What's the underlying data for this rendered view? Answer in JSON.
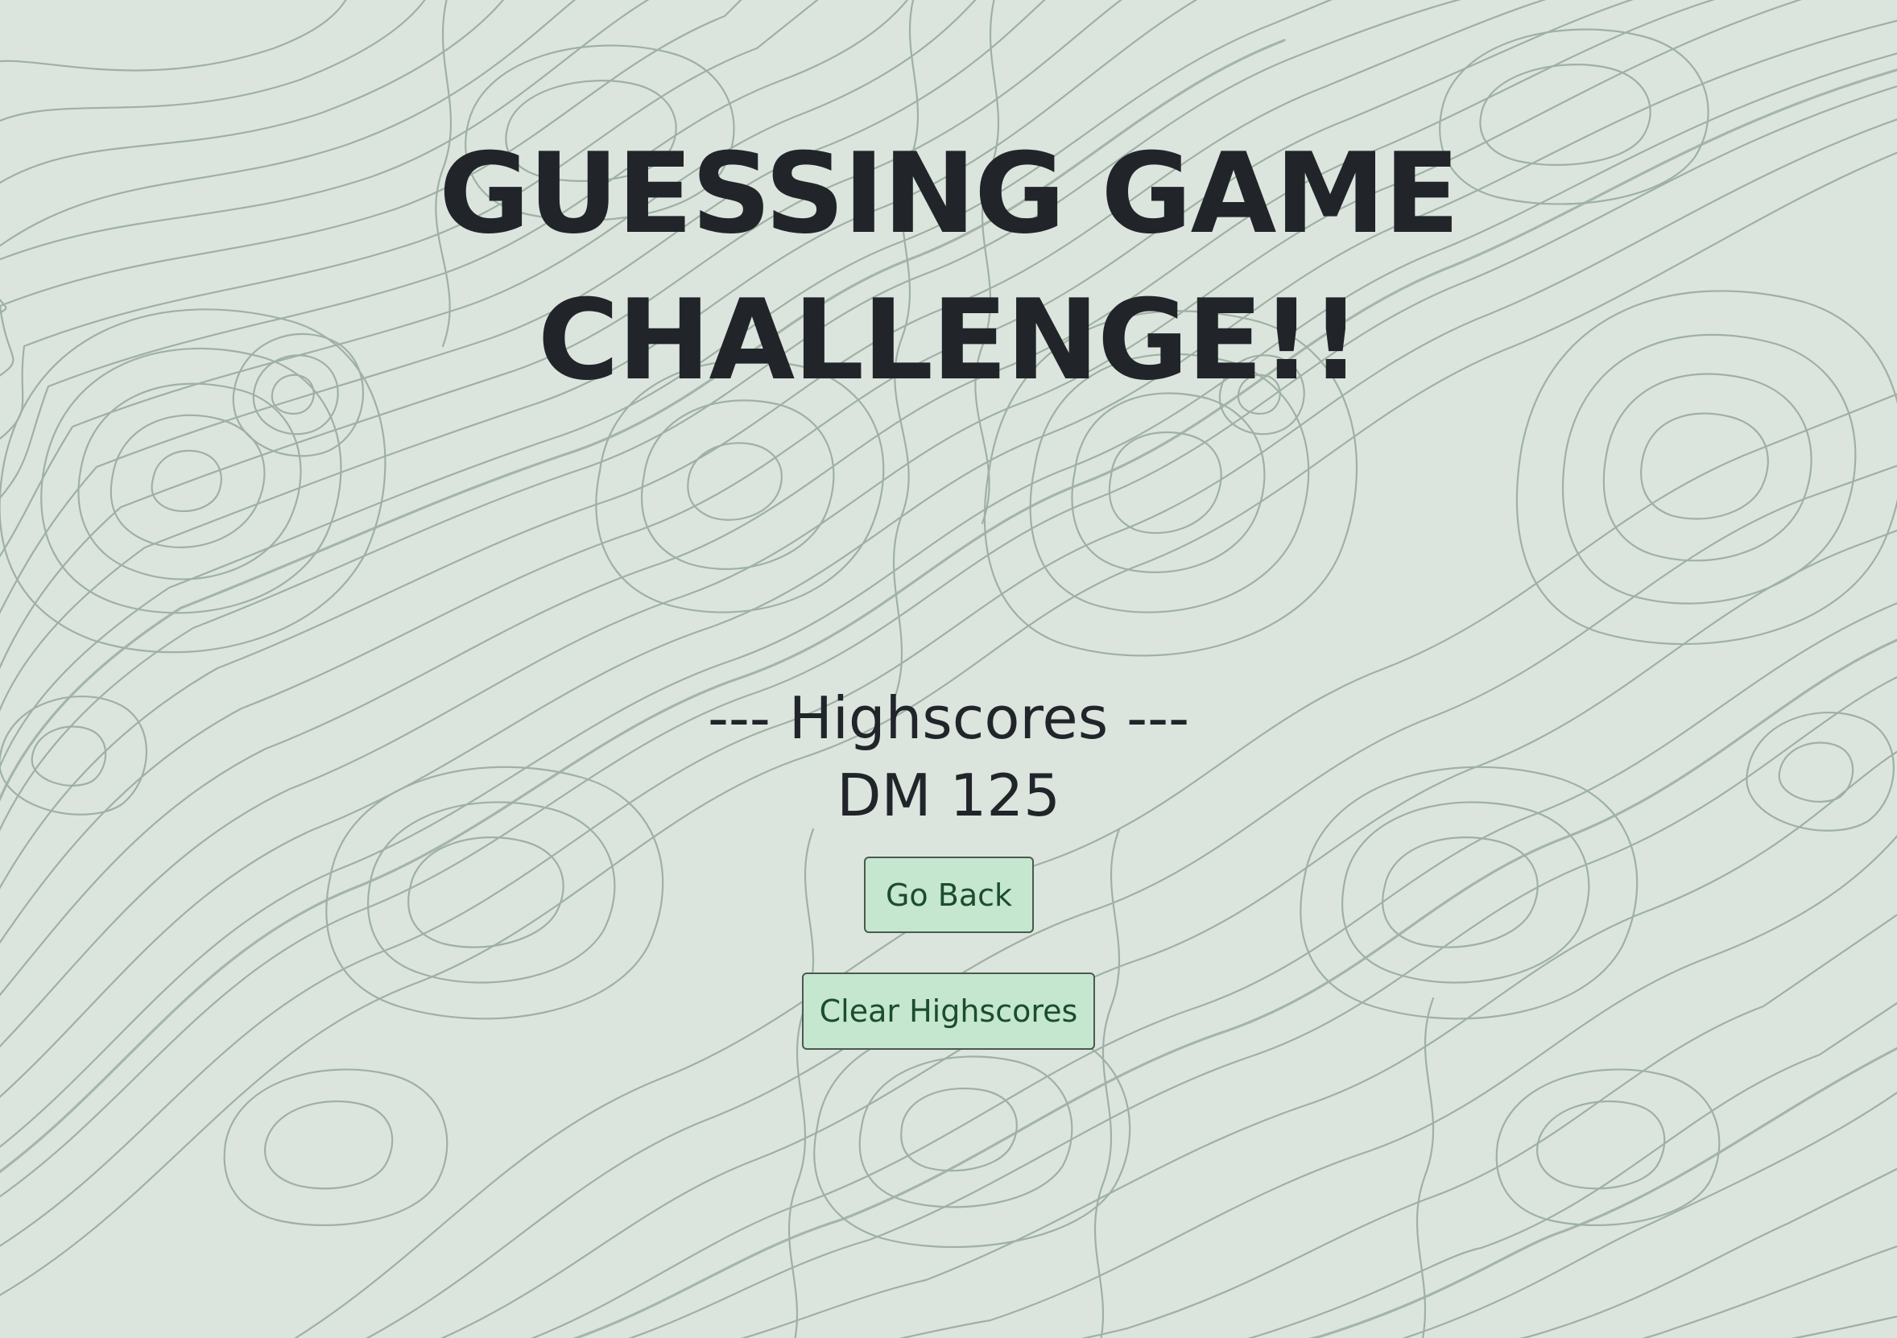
{
  "page": {
    "title_line1": "GUESSING GAME",
    "title_line2": "CHALLENGE!!"
  },
  "highscores": {
    "heading": "--- Highscores ---",
    "entries": [
      {
        "text": "DM 125"
      }
    ]
  },
  "buttons": {
    "go_back": "Go Back",
    "clear_highscores": "Clear Highscores"
  },
  "colors": {
    "background": "#dbe5de",
    "contour_lines": "#9fb0a4",
    "text": "#212529",
    "button_bg": "#c5e6cf",
    "button_text": "#1b4d2c"
  }
}
